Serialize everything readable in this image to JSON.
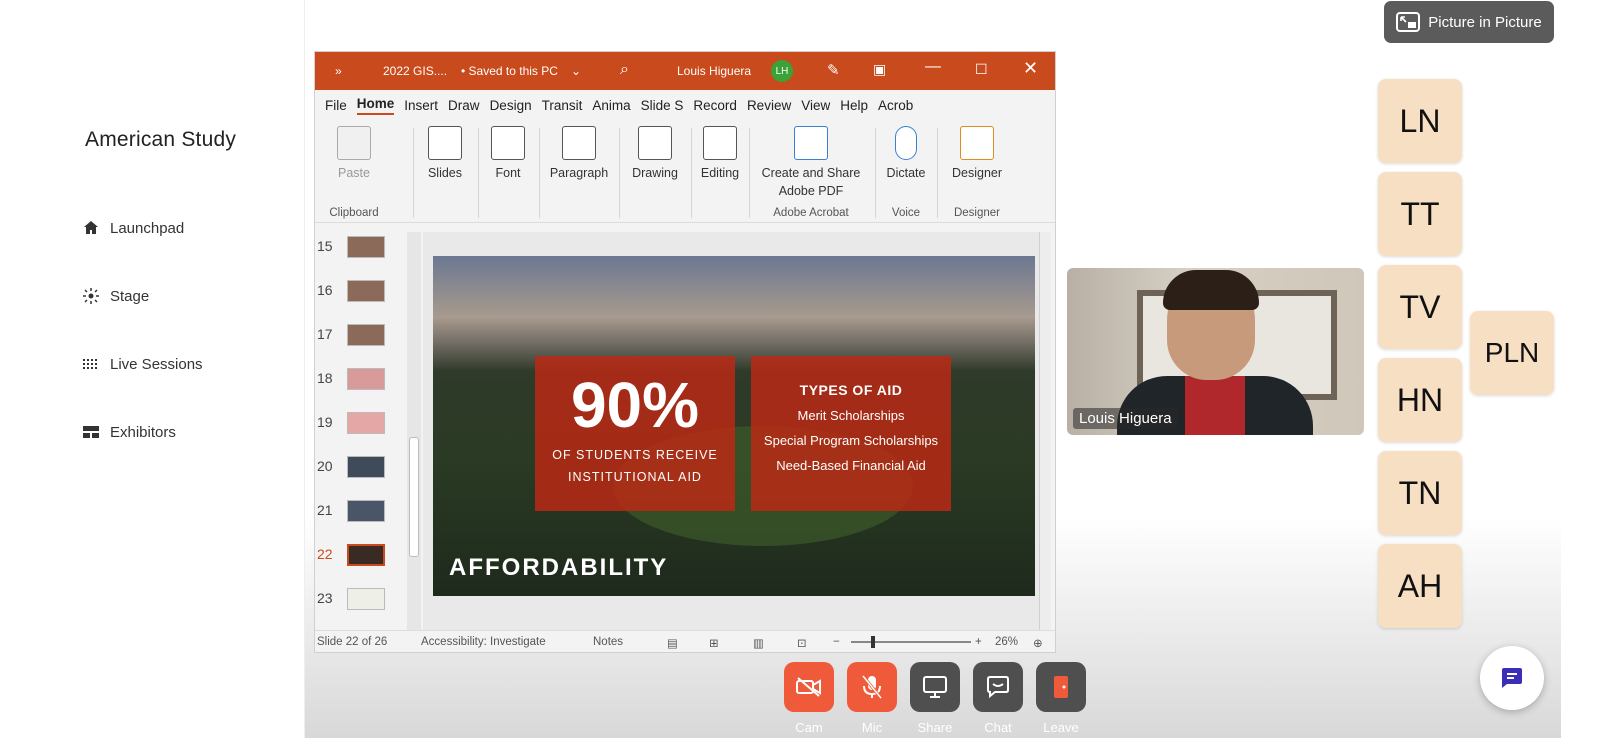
{
  "sidebar": {
    "brand": "American Study",
    "items": [
      {
        "label": "Launchpad"
      },
      {
        "label": "Stage"
      },
      {
        "label": "Live Sessions"
      },
      {
        "label": "Exhibitors"
      }
    ]
  },
  "pip": {
    "label": "Picture in Picture"
  },
  "ppt": {
    "file": "2022 GIS....",
    "saved": "• Saved to this PC",
    "user": "Louis Higuera",
    "user_initials": "LH",
    "tabs": [
      "File",
      "Home",
      "Insert",
      "Draw",
      "Design",
      "Transit",
      "Anima",
      "Slide S",
      "Record",
      "Review",
      "View",
      "Help",
      "Acrob"
    ],
    "ribbon": {
      "paste": "Paste",
      "clipboard": "Clipboard",
      "slides": "Slides",
      "font": "Font",
      "paragraph": "Paragraph",
      "drawing": "Drawing",
      "editing": "Editing",
      "create_share_1": "Create and Share",
      "create_share_2": "Adobe PDF",
      "adobe_acrobat": "Adobe Acrobat",
      "dictate": "Dictate",
      "voice": "Voice",
      "designer": "Designer",
      "designer_group": "Designer"
    },
    "thumbnails": [
      "15",
      "16",
      "17",
      "18",
      "19",
      "20",
      "21",
      "22",
      "23"
    ],
    "current_slide": "22",
    "slide": {
      "big": "90%",
      "sub1": "OF STUDENTS RECEIVE",
      "sub2": "INSTITUTIONAL AID",
      "aid_title": "TYPES OF AID",
      "aid1": "Merit Scholarships",
      "aid2": "Special Program Scholarships",
      "aid3": "Need-Based Financial Aid",
      "title": "AFFORDABILITY"
    },
    "status": {
      "slide_of": "Slide 22 of 26",
      "accessibility": "Accessibility: Investigate",
      "notes": "Notes",
      "zoom": "26%"
    }
  },
  "video": {
    "name": "Louis Higuera"
  },
  "participants": [
    "LN",
    "TT",
    "TV",
    "HN",
    "TN",
    "AH",
    "PLN"
  ],
  "controls": [
    {
      "label": "Cam"
    },
    {
      "label": "Mic"
    },
    {
      "label": "Share"
    },
    {
      "label": "Chat"
    },
    {
      "label": "Leave"
    }
  ],
  "colors": {
    "accent_orange": "#ee5a3a",
    "ppt_red": "#c94a1c",
    "tile": "#f7dfc4",
    "chat_fab_icon": "#3b2fb8"
  }
}
